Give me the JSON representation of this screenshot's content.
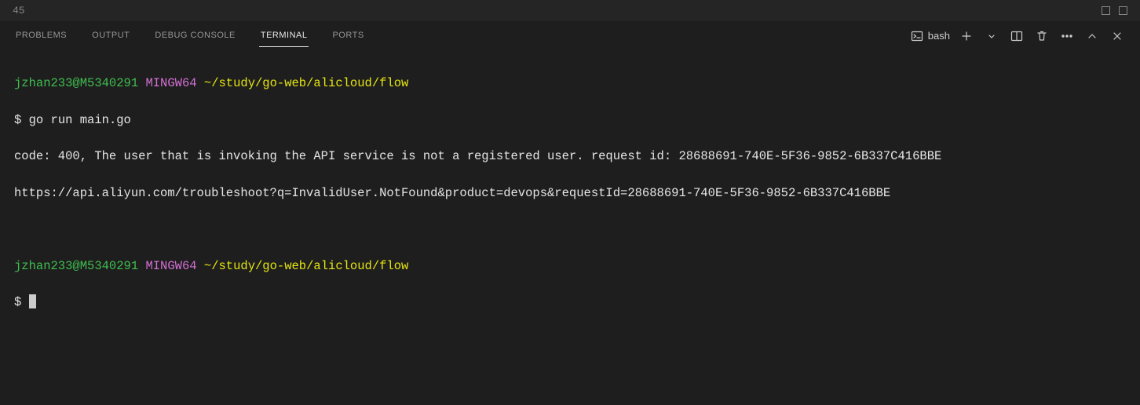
{
  "topbar": {
    "line_number": "45"
  },
  "tabs": {
    "problems": "PROBLEMS",
    "output": "OUTPUT",
    "debug": "DEBUG CONSOLE",
    "terminal": "TERMINAL",
    "ports": "PORTS"
  },
  "toolbar": {
    "shell": "bash"
  },
  "terminal": {
    "user": "jzhan233@M5340291",
    "mingw": "MINGW64",
    "path": "~/study/go-web/alicloud/flow",
    "prompt": "$",
    "cmd1": "go run main.go",
    "out1": "code: 400, The user that is invoking the API service is not a registered user. request id: 28688691-740E-5F36-9852-6B337C416BBE",
    "out2": "https://api.aliyun.com/troubleshoot?q=InvalidUser.NotFound&product=devops&requestId=28688691-740E-5F36-9852-6B337C416BBE"
  }
}
